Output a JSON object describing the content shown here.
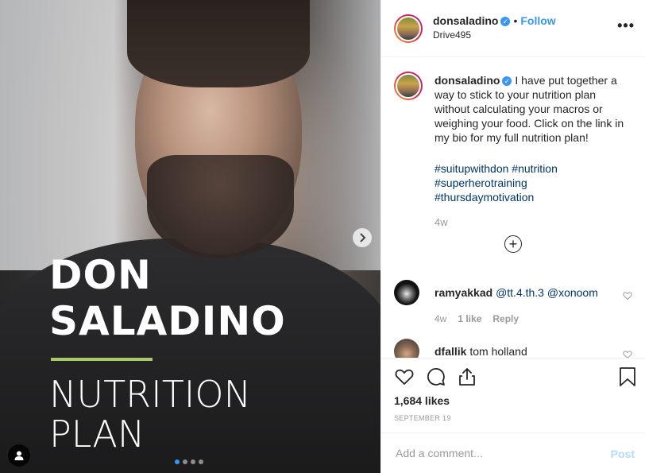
{
  "media": {
    "title_line1": "DON",
    "title_line2": "SALADINO",
    "subtitle_line1": "NUTRITION",
    "subtitle_line2": "PLAN",
    "accent_bar_color": "#a8c86a",
    "carousel": {
      "total": 4,
      "active": 1
    }
  },
  "header": {
    "username": "donsaladino",
    "separator": "•",
    "follow_label": "Follow",
    "location": "Drive495",
    "more_label": "•••"
  },
  "caption": {
    "username": "donsaladino",
    "text": "I have put together a way to stick to your nutrition plan without calculating your macros or weighing your food. Click on the link in my bio for my full nutrition plan!",
    "hashtags": [
      "#suitupwithdon #nutrition",
      "#superherotraining",
      "#thursdaymotivation"
    ],
    "age": "4w",
    "load_more": "+"
  },
  "comments": [
    {
      "username": "ramyakkad",
      "text": "@tt.4.th.3 @xonoom",
      "age": "4w",
      "likes": "1 like",
      "reply": "Reply"
    },
    {
      "username": "dfallik",
      "text": "tom holland"
    }
  ],
  "actions": {
    "likes": "1,684 likes",
    "date": "SEPTEMBER 19"
  },
  "add_comment": {
    "placeholder": "Add a comment...",
    "post_label": "Post"
  },
  "colors": {
    "link": "#3897f0",
    "hashtag": "#003569",
    "muted": "#999999"
  }
}
